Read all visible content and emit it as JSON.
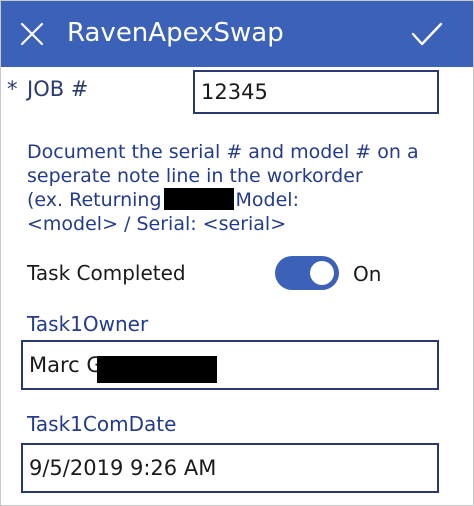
{
  "header": {
    "title": "RavenApexSwap",
    "colors": {
      "bar": "#3b61b8",
      "text": "#ffffff"
    }
  },
  "form": {
    "job": {
      "required_marker": "*",
      "label": "JOB #",
      "value": "12345"
    },
    "note": {
      "line1": "Document the serial # and model # on a",
      "line2": "seperate note line in the workorder",
      "line3_start": "(ex. Returning",
      "line3_end": "Model:",
      "line4": "<model> / Serial: <serial>"
    },
    "task_completed": {
      "label": "Task Completed",
      "state_label": "On",
      "on": true
    },
    "task1_owner": {
      "label": "Task1Owner",
      "value": "Marc G"
    },
    "task1_com_date": {
      "label": "Task1ComDate",
      "value": "9/5/2019 9:26 AM"
    },
    "colors": {
      "label": "#233b8c",
      "border": "#2b3a6e",
      "accent": "#3b61b8"
    }
  },
  "icons": {
    "close": "close-icon",
    "confirm": "checkmark-icon"
  }
}
